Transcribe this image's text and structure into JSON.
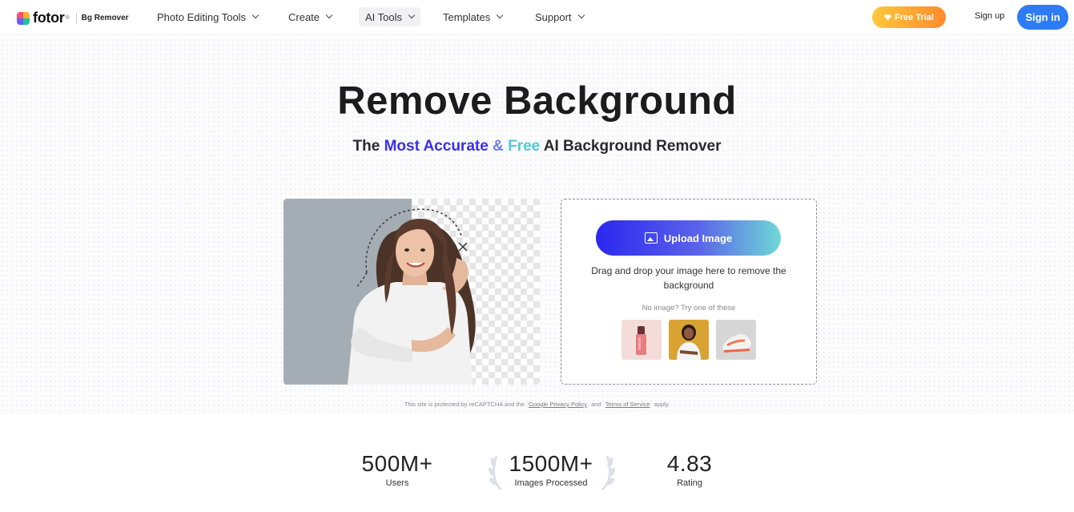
{
  "header": {
    "logo_text": "fotor",
    "logo_registered": "®",
    "logo_product": "Bg Remover",
    "nav": [
      {
        "label": "Photo Editing Tools"
      },
      {
        "label": "Create"
      },
      {
        "label": "AI Tools"
      },
      {
        "label": "Templates"
      },
      {
        "label": "Support"
      }
    ],
    "free_trial": "Free Trial",
    "sign_up": "Sign up",
    "sign_in": "Sign in",
    "colors": {
      "trial_start": "#ffc93a",
      "trial_end": "#ff8a2b",
      "sign_in": "#2d7cf6"
    }
  },
  "hero": {
    "title": "Remove Background",
    "subtitle_parts": {
      "p1": "The ",
      "p2": "Most Accurate",
      "p3": " & ",
      "p4": "Free",
      "p5": " AI Background Remover"
    }
  },
  "upload": {
    "button_label": "Upload Image",
    "description": "Drag and drop your image here to remove the background",
    "try_text": "No image?  Try one of these",
    "samples": [
      {
        "name": "lipstick-sample"
      },
      {
        "name": "woman-sample"
      },
      {
        "name": "sneaker-sample"
      }
    ]
  },
  "legal": {
    "prefix": "This site is protected by reCAPTCHA and the",
    "privacy": "Google Privacy Policy",
    "and": "and",
    "terms": "Terms of Service",
    "suffix": "apply."
  },
  "stats": [
    {
      "value": "500M+",
      "label": "Users"
    },
    {
      "value": "1500M+",
      "label": "Images Processed"
    },
    {
      "value": "4.83",
      "label": "Rating"
    }
  ]
}
